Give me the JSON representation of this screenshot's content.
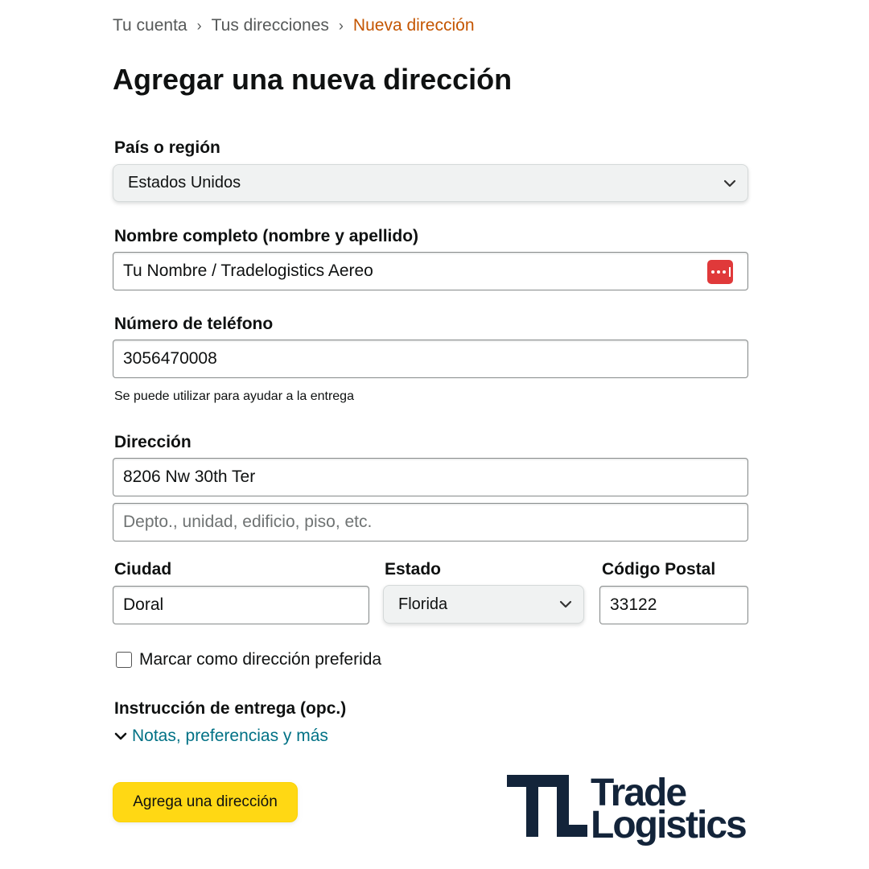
{
  "breadcrumb": {
    "items": [
      "Tu cuenta",
      "Tus direcciones"
    ],
    "current": "Nueva dirección",
    "separator": "›"
  },
  "page_title": "Agregar una nueva dirección",
  "form": {
    "country": {
      "label": "País o región",
      "value": "Estados Unidos"
    },
    "full_name": {
      "label": "Nombre completo (nombre y apellido)",
      "value": "Tu Nombre / Tradelogistics Aereo",
      "autofill_icon": "password-manager-icon"
    },
    "phone": {
      "label": "Número de teléfono",
      "value": "3056470008",
      "hint": "Se puede utilizar para ayudar a la entrega"
    },
    "address": {
      "label": "Dirección",
      "line1_value": "8206 Nw 30th Ter",
      "line2_placeholder": "Depto., unidad, edificio, piso, etc."
    },
    "city": {
      "label": "Ciudad",
      "value": "Doral"
    },
    "state": {
      "label": "Estado",
      "value": "Florida"
    },
    "postal_code": {
      "label": "Código Postal",
      "value": "33122"
    },
    "preferred": {
      "label": "Marcar como dirección preferida",
      "checked": false
    },
    "delivery_instructions": {
      "label": "Instrucción de entrega (opc.)",
      "link": "Notas, preferencias y más"
    },
    "submit_label": "Agrega una dirección"
  },
  "logo": {
    "line1": "Trade",
    "line2": "Logistics",
    "color": "#13243a"
  },
  "colors": {
    "accent_button": "#ffd814",
    "link": "#007185",
    "breadcrumb_current": "#c45500",
    "autofill_icon": "#e0393a"
  }
}
